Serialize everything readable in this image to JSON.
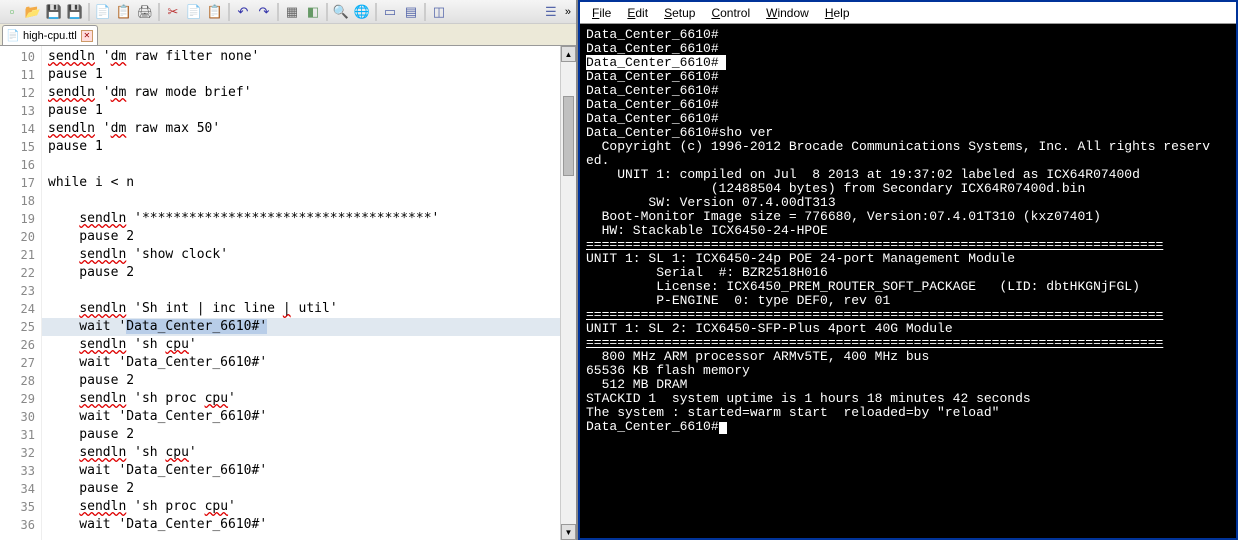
{
  "toolbar_icons": [
    {
      "name": "new-icon",
      "glyph": "▫",
      "color": "#6b6"
    },
    {
      "name": "open-icon",
      "glyph": "📂",
      "color": "#da0"
    },
    {
      "name": "save-icon",
      "glyph": "💾",
      "color": "#55a"
    },
    {
      "name": "save-all-icon",
      "glyph": "💾",
      "color": "#77b"
    },
    {
      "sep": true
    },
    {
      "name": "copy-2-icon",
      "glyph": "📄",
      "color": "#888"
    },
    {
      "name": "paste-2-icon",
      "glyph": "📋",
      "color": "#888"
    },
    {
      "name": "print-icon",
      "glyph": "🖨",
      "color": "#555"
    },
    {
      "sep": true
    },
    {
      "name": "cut-icon",
      "glyph": "✂",
      "color": "#b33"
    },
    {
      "name": "copy-icon",
      "glyph": "📄",
      "color": "#888"
    },
    {
      "name": "paste-icon",
      "glyph": "📋",
      "color": "#888"
    },
    {
      "sep": true
    },
    {
      "name": "undo-icon",
      "glyph": "↶",
      "color": "#33a"
    },
    {
      "name": "redo-icon",
      "glyph": "↷",
      "color": "#33a"
    },
    {
      "sep": true
    },
    {
      "name": "pkg-icon",
      "glyph": "▦",
      "color": "#666"
    },
    {
      "name": "box-icon",
      "glyph": "◧",
      "color": "#696"
    },
    {
      "sep": true
    },
    {
      "name": "search-icon",
      "glyph": "🔍",
      "color": "#56a"
    },
    {
      "name": "globe-icon",
      "glyph": "🌐",
      "color": "#489"
    },
    {
      "sep": true
    },
    {
      "name": "win-icon",
      "glyph": "▭",
      "color": "#56a"
    },
    {
      "name": "win2-icon",
      "glyph": "▤",
      "color": "#56a"
    },
    {
      "sep": true
    },
    {
      "name": "panel-icon",
      "glyph": "◫",
      "color": "#56a"
    },
    {
      "name": "spacer",
      "glyph": "",
      "color": ""
    },
    {
      "name": "panel2-icon",
      "glyph": "☰",
      "color": "#56a"
    }
  ],
  "toolbar_more": "»",
  "tab": {
    "label": "high-cpu.ttl",
    "close": "✕"
  },
  "code_lines": [
    {
      "n": 10,
      "text": "sendln 'dm raw filter none'",
      "ul": [
        0,
        1
      ]
    },
    {
      "n": 11,
      "text": "pause 1"
    },
    {
      "n": 12,
      "text": "sendln 'dm raw mode brief'",
      "ul": [
        0,
        1
      ]
    },
    {
      "n": 13,
      "text": "pause 1"
    },
    {
      "n": 14,
      "text": "sendln 'dm raw max 50'",
      "ul": [
        0,
        1
      ]
    },
    {
      "n": 15,
      "text": "pause 1"
    },
    {
      "n": 16,
      "text": ""
    },
    {
      "n": 17,
      "text": "while i < n"
    },
    {
      "n": 18,
      "text": ""
    },
    {
      "n": 19,
      "text": "    sendln '*************************************'",
      "ul": [
        0
      ]
    },
    {
      "n": 20,
      "text": "    pause 2"
    },
    {
      "n": 21,
      "text": "    sendln 'show clock'",
      "ul": [
        0
      ]
    },
    {
      "n": 22,
      "text": "    pause 2"
    },
    {
      "n": 23,
      "text": ""
    },
    {
      "n": 24,
      "text": "    sendln 'Sh int | inc line | util'",
      "ul": [
        0,
        6
      ]
    },
    {
      "n": 25,
      "text": "    wait 'Data_Center_6610#'",
      "hl": true,
      "selStart": 10,
      "selEnd": 28
    },
    {
      "n": 26,
      "text": "    sendln 'sh cpu'",
      "ul": [
        0,
        2
      ]
    },
    {
      "n": 27,
      "text": "    wait 'Data_Center_6610#'"
    },
    {
      "n": 28,
      "text": "    pause 2"
    },
    {
      "n": 29,
      "text": "    sendln 'sh proc cpu'",
      "ul": [
        0,
        3
      ]
    },
    {
      "n": 30,
      "text": "    wait 'Data_Center_6610#'"
    },
    {
      "n": 31,
      "text": "    pause 2"
    },
    {
      "n": 32,
      "text": "    sendln 'sh cpu'",
      "ul": [
        0,
        2
      ]
    },
    {
      "n": 33,
      "text": "    wait 'Data_Center_6610#'"
    },
    {
      "n": 34,
      "text": "    pause 2"
    },
    {
      "n": 35,
      "text": "    sendln 'sh proc cpu'",
      "ul": [
        0,
        3
      ]
    },
    {
      "n": 36,
      "text": "    wait 'Data_Center_6610#'"
    }
  ],
  "menus": [
    {
      "label": "File",
      "u": 0
    },
    {
      "label": "Edit",
      "u": 0
    },
    {
      "label": "Setup",
      "u": 0
    },
    {
      "label": "Control",
      "u": 0
    },
    {
      "label": "Window",
      "u": 0
    },
    {
      "label": "Help",
      "u": 0
    }
  ],
  "terminal_lines": [
    "Data_Center_6610#",
    "Data_Center_6610#",
    {
      "sel": "Data_Center_6610# "
    },
    "Data_Center_6610#",
    "Data_Center_6610#",
    "Data_Center_6610#",
    "Data_Center_6610#",
    "Data_Center_6610#sho ver",
    "  Copyright (c) 1996-2012 Brocade Communications Systems, Inc. All rights reserv",
    "ed.",
    "    UNIT 1: compiled on Jul  8 2013 at 19:37:02 labeled as ICX64R07400d",
    "                (12488504 bytes) from Secondary ICX64R07400d.bin",
    "        SW: Version 07.4.00dT313",
    "  Boot-Monitor Image size = 776680, Version:07.4.01T310 (kxz07401)",
    "  HW: Stackable ICX6450-24-HPOE",
    {
      "sep": "=========================================================================="
    },
    "UNIT 1: SL 1: ICX6450-24p POE 24-port Management Module",
    "         Serial  #: BZR2518H016",
    "         License: ICX6450_PREM_ROUTER_SOFT_PACKAGE   (LID: dbtHKGNjFGL)",
    "         P-ENGINE  0: type DEF0, rev 01",
    {
      "sep": "=========================================================================="
    },
    "UNIT 1: SL 2: ICX6450-SFP-Plus 4port 40G Module",
    {
      "sep": "=========================================================================="
    },
    "  800 MHz ARM processor ARMv5TE, 400 MHz bus",
    "65536 KB flash memory",
    "  512 MB DRAM",
    "STACKID 1  system uptime is 1 hours 18 minutes 42 seconds",
    "The system : started=warm start  reloaded=by \"reload\"",
    "",
    {
      "prompt": "Data_Center_6610#"
    }
  ]
}
